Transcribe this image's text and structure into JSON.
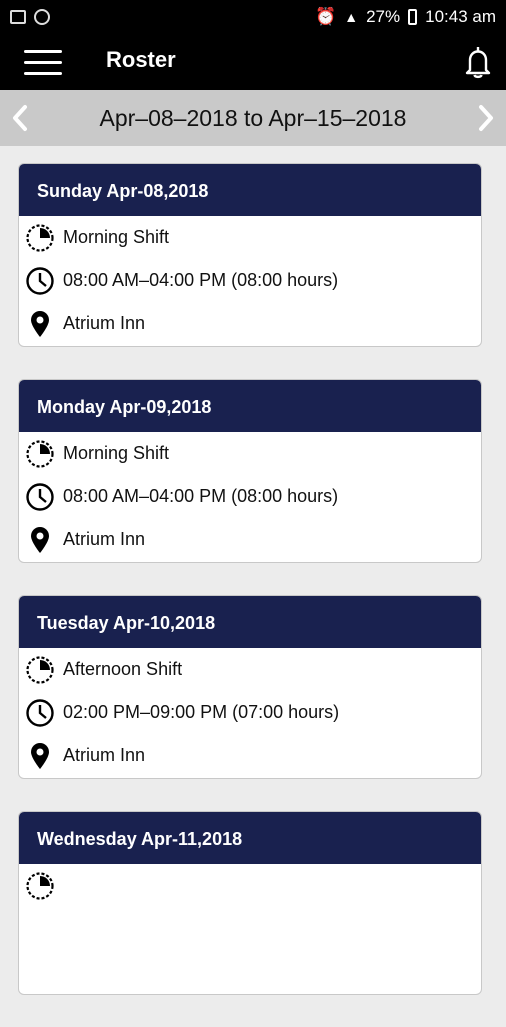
{
  "status_bar": {
    "battery": "27%",
    "time": "10:43 am"
  },
  "app_bar": {
    "title": "Roster"
  },
  "date_range": {
    "label": "Apr–08–2018 to Apr–15–2018"
  },
  "roster": [
    {
      "day": "Sunday Apr-08,2018",
      "shift": "Morning Shift",
      "time": "08:00 AM–04:00 PM (08:00 hours)",
      "location": "Atrium Inn"
    },
    {
      "day": "Monday Apr-09,2018",
      "shift": "Morning Shift",
      "time": "08:00 AM–04:00 PM (08:00 hours)",
      "location": "Atrium Inn"
    },
    {
      "day": "Tuesday Apr-10,2018",
      "shift": "Afternoon Shift",
      "time": "02:00 PM–09:00 PM (07:00 hours)",
      "location": "Atrium Inn"
    },
    {
      "day": "Wednesday Apr-11,2018"
    }
  ],
  "colors": {
    "card_header": "#19214f",
    "date_bar": "#c9c9c9",
    "app_bar": "#000000"
  },
  "icons": {
    "menu": "hamburger-icon",
    "notifications": "bell-icon",
    "prev": "chevron-left-icon",
    "next": "chevron-right-icon",
    "shift": "shift-clock-icon",
    "time": "clock-icon",
    "location": "location-pin-icon"
  }
}
